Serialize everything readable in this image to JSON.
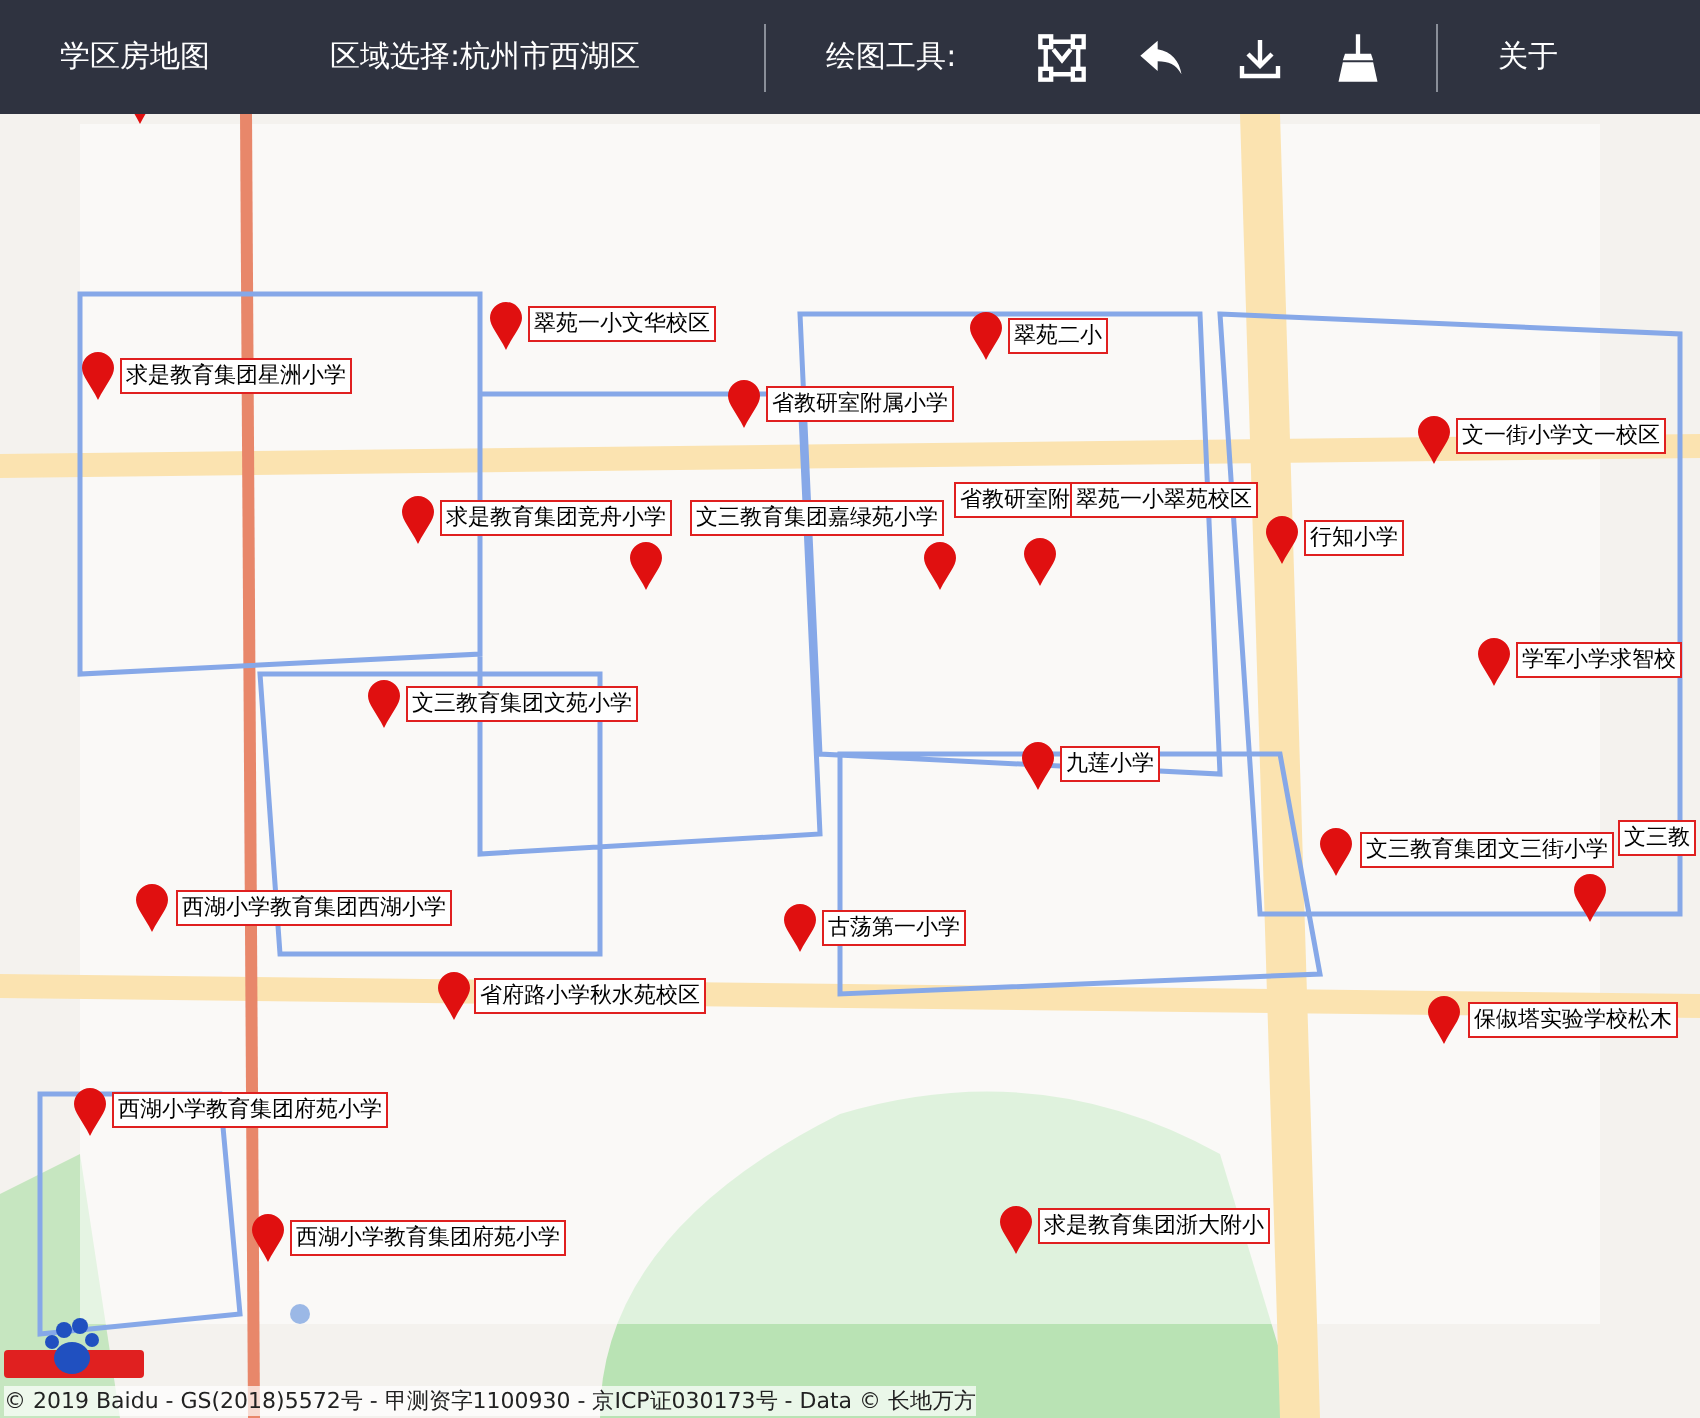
{
  "toolbar": {
    "title": "学区房地图",
    "region": "区域选择:杭州市西湖区",
    "tools_label": "绘图工具:",
    "about": "关于"
  },
  "markers": [
    {
      "label": "翠苑一小文华校区"
    },
    {
      "label": "求是教育集团星洲小学"
    },
    {
      "label": "翠苑二小"
    },
    {
      "label": "省教研室附属小学"
    },
    {
      "label": "文一街小学文一校区"
    },
    {
      "label": "求是教育集团竞舟小学"
    },
    {
      "label": "文三教育集团嘉绿苑小学"
    },
    {
      "label": "省教研室附"
    },
    {
      "label": "翠苑一小翠苑校区"
    },
    {
      "label": "行知小学"
    },
    {
      "label": "学军小学求智校"
    },
    {
      "label": "文三教育集团文苑小学"
    },
    {
      "label": "九莲小学"
    },
    {
      "label": "文三教育集团文三街小学"
    },
    {
      "label": "文三教"
    },
    {
      "label": "西湖小学教育集团西湖小学"
    },
    {
      "label": "古荡第一小学"
    },
    {
      "label": "省府路小学秋水苑校区"
    },
    {
      "label": "保俶塔实验学校松木"
    },
    {
      "label": "西湖小学教育集团府苑小学"
    },
    {
      "label": "西湖小学教育集团府苑小学"
    },
    {
      "label": "求是教育集团浙大附小"
    }
  ],
  "copyright": "© 2019 Baidu - GS(2018)5572号 - 甲测资字1100930 - 京ICP证030173号 - Data © 长地万方"
}
